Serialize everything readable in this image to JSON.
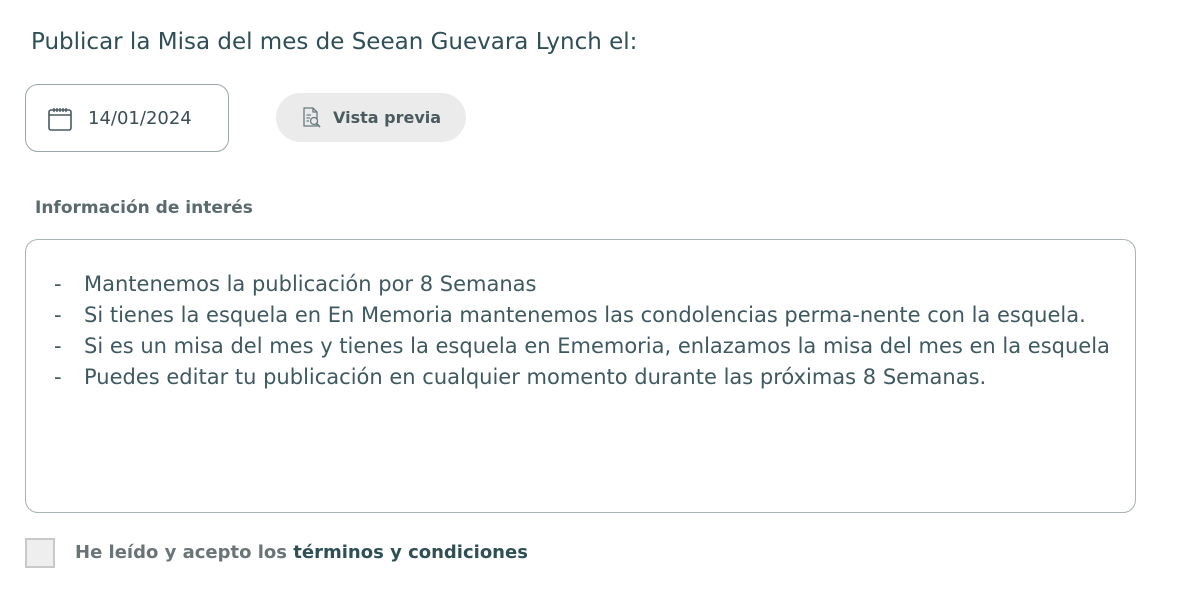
{
  "header": {
    "title": "Publicar la Misa del mes de Seean Guevara Lynch el:"
  },
  "date_field": {
    "value": "14/01/2024",
    "icon": "calendar-icon"
  },
  "preview_button": {
    "label": "Vista previa",
    "icon": "document-search-icon"
  },
  "info": {
    "title": "Información de interés",
    "items": [
      "Mantenemos la publicación por 8 Semanas",
      "Si tienes la esquela en En Memoria mantenemos las condolencias perma-nente con la esquela.",
      "Si es un misa del mes y tienes la esquela en Ememoria, enlazamos la misa del mes en la esquela",
      "Puedes editar tu publicación en cualquier momento durante las  próximas 8 Semanas."
    ]
  },
  "terms": {
    "prefix": "He leído y acepto los",
    "link": "términos y condiciones",
    "checked": false
  },
  "colors": {
    "text_primary": "#2f4f57",
    "border": "#a9b3b6",
    "button_bg": "#ebebeb",
    "checkbox_bg": "#eeeeee"
  }
}
